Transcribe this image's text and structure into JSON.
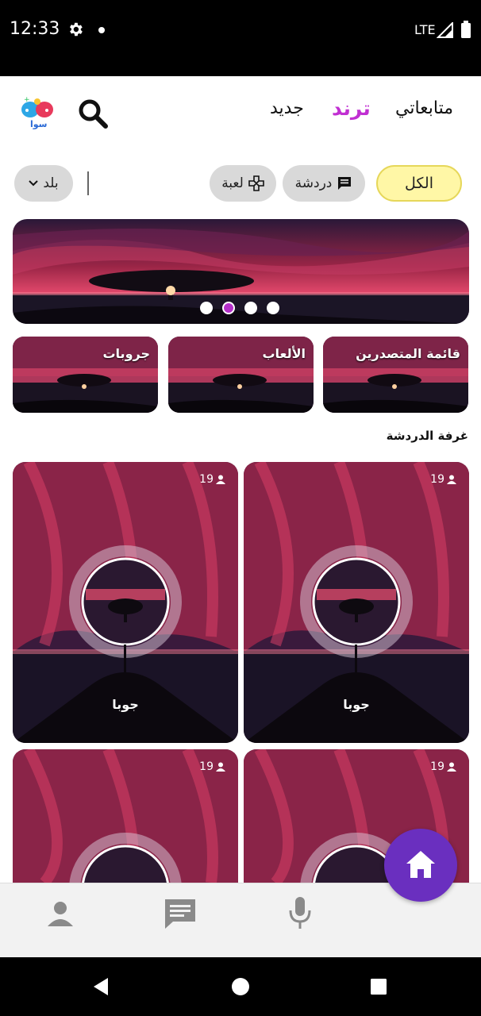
{
  "status_bar": {
    "time": "12:33",
    "network": "LTE",
    "icons": [
      "settings-icon",
      "notification-dot",
      "signal-icon",
      "battery-icon"
    ]
  },
  "top_nav": {
    "logo_text": "سوا",
    "tabs": [
      {
        "label": "متابعاتي",
        "active": false
      },
      {
        "label": "ترند",
        "active": true
      },
      {
        "label": "جديد",
        "active": false
      }
    ],
    "accent_color": "#c12fd2"
  },
  "filters": {
    "all": "الكل",
    "chat": "دردشة",
    "game": "لعبة",
    "country": "بلد"
  },
  "banner": {
    "page_count": 4,
    "active_page": 2
  },
  "categories": [
    {
      "label": "قائمة المتصدرين"
    },
    {
      "label": "الألعاب"
    },
    {
      "label": "جروبات"
    }
  ],
  "section": {
    "title": "غرفة الدردشة"
  },
  "rooms": [
    {
      "name": "جوبا",
      "count": "19"
    },
    {
      "name": "جوبا",
      "count": "19"
    },
    {
      "name": "",
      "count": "19"
    },
    {
      "name": "",
      "count": "19"
    }
  ],
  "bottom_nav": {
    "items": [
      "profile-icon",
      "messages-icon",
      "microphone-icon",
      "home-icon"
    ],
    "fab_color": "#6a2fbf"
  },
  "system_nav": {
    "items": [
      "back-icon",
      "home-circle-icon",
      "recents-icon"
    ]
  }
}
